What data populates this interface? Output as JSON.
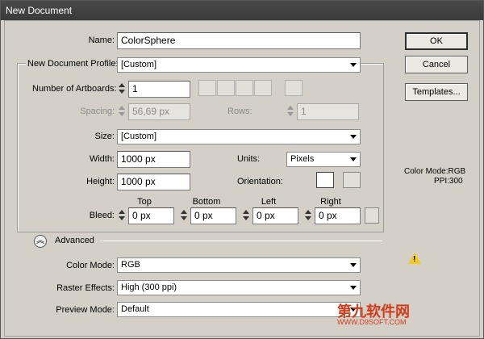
{
  "window": {
    "title": "New Document"
  },
  "form": {
    "name": {
      "label": "Name:",
      "value": "ColorSphere"
    },
    "profile": {
      "label": "New Document Profile:",
      "value": "[Custom]"
    },
    "artboards": {
      "label": "Number of Artboards:",
      "value": "1"
    },
    "spacing": {
      "label": "Spacing:",
      "value": "56,69 px"
    },
    "rows": {
      "label": "Rows:",
      "value": "1"
    },
    "size": {
      "label": "Size:",
      "value": "[Custom]"
    },
    "width": {
      "label": "Width:",
      "value": "1000 px"
    },
    "height": {
      "label": "Height:",
      "value": "1000 px"
    },
    "units": {
      "label": "Units:",
      "value": "Pixels"
    },
    "orientation": {
      "label": "Orientation:"
    },
    "bleed": {
      "label": "Bleed:",
      "top_label": "Top",
      "bottom_label": "Bottom",
      "left_label": "Left",
      "right_label": "Right",
      "top": "0 px",
      "bottom": "0 px",
      "left": "0 px",
      "right": "0 px"
    },
    "advanced": {
      "label": "Advanced"
    },
    "color_mode": {
      "label": "Color Mode:",
      "value": "RGB"
    },
    "raster_effects": {
      "label": "Raster Effects:",
      "value": "High (300 ppi)"
    },
    "preview_mode": {
      "label": "Preview Mode:",
      "value": "Default"
    }
  },
  "buttons": {
    "ok": "OK",
    "cancel": "Cancel",
    "templates": "Templates..."
  },
  "info": {
    "color_mode": "Color Mode:RGB",
    "ppi": "PPI:300"
  },
  "watermark": {
    "line1": "第九软件网",
    "line2": "WWW.D9SOFT.COM"
  },
  "colors": {
    "titlebar": "#3a3a3a",
    "dialog": "#d4d0c8",
    "warning": "#f2cc1a",
    "watermark": "#d23b1a"
  }
}
